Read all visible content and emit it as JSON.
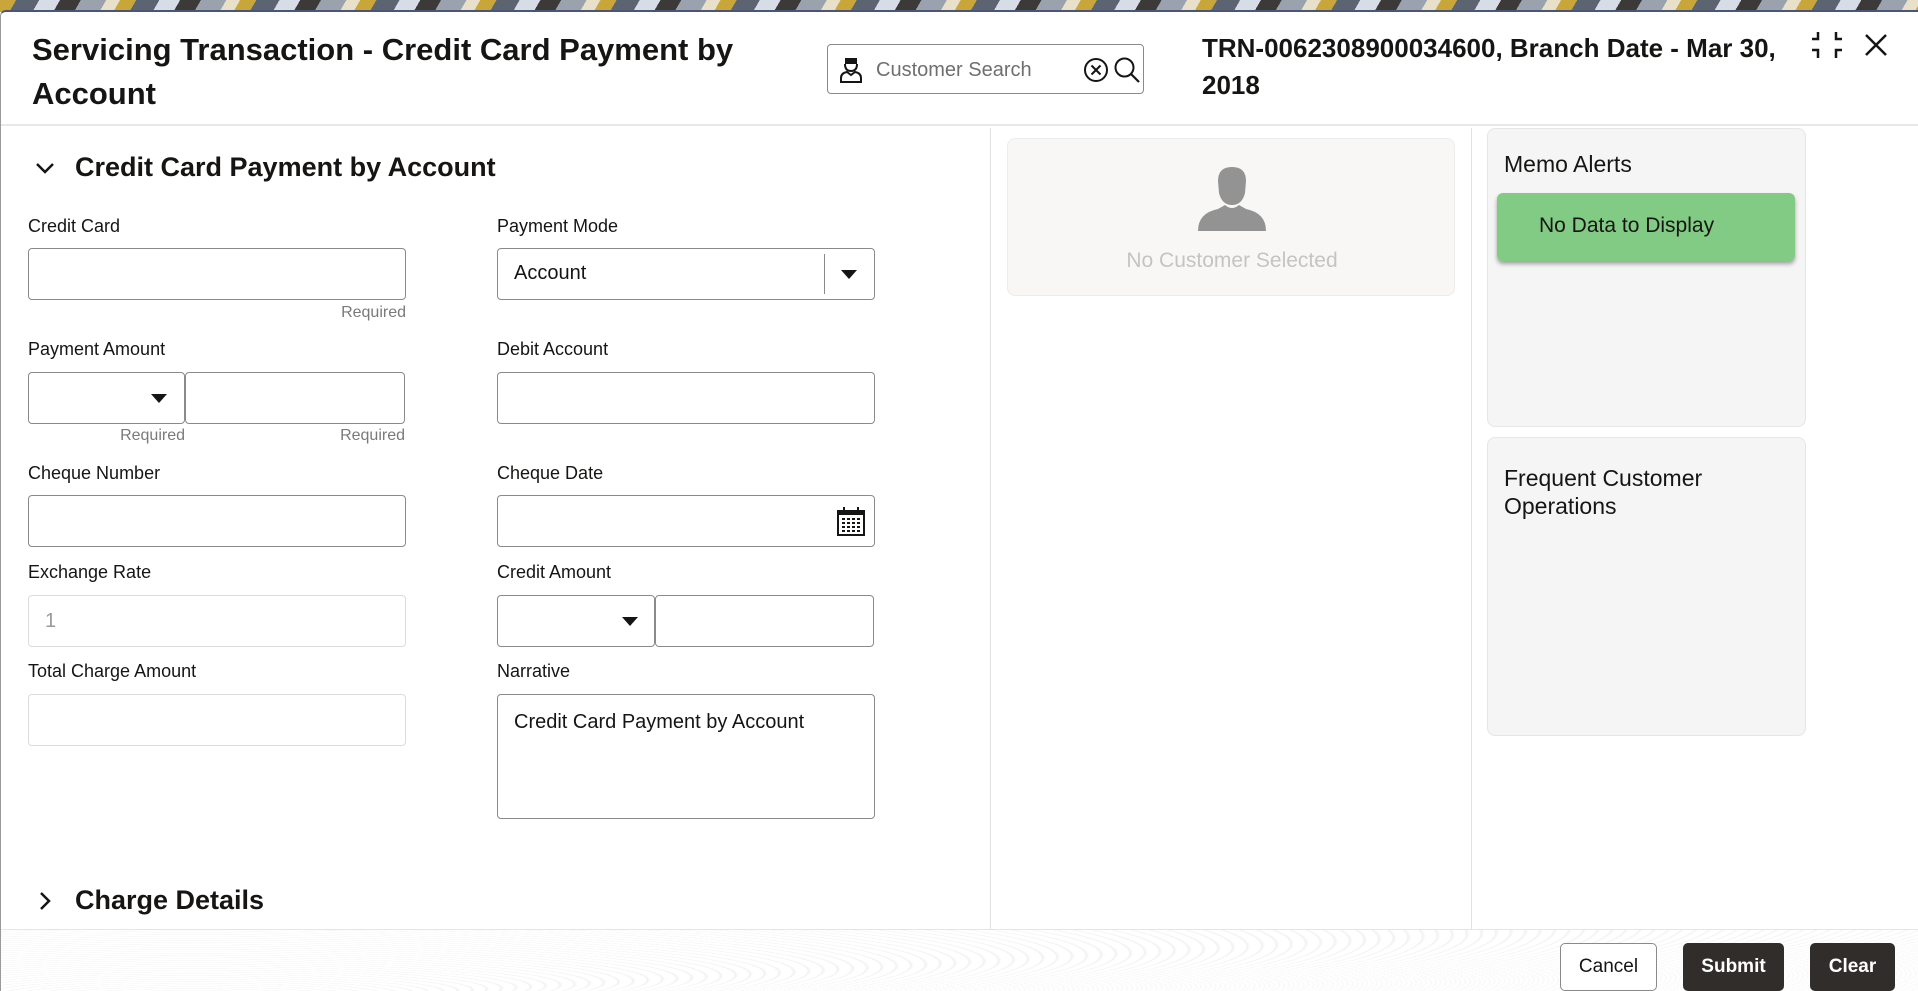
{
  "header": {
    "title": "Servicing Transaction - Credit Card Payment by Account",
    "search": {
      "placeholder": "Customer Search",
      "value": ""
    },
    "transaction_info": "TRN-0062308900034600, Branch Date - Mar 30, 2018",
    "icons": {
      "person": "person-icon",
      "clear": "circle-x-icon",
      "search": "magnifier-icon",
      "minimize": "minimize-icon",
      "close": "close-icon"
    }
  },
  "form": {
    "section_title": "Credit Card Payment by Account",
    "required_text": "Required",
    "fields": {
      "credit_card": {
        "label": "Credit Card",
        "value": ""
      },
      "payment_mode": {
        "label": "Payment Mode",
        "value": "Account"
      },
      "payment_amount": {
        "label": "Payment Amount",
        "currency": "",
        "amount": ""
      },
      "debit_account": {
        "label": "Debit Account",
        "value": ""
      },
      "cheque_number": {
        "label": "Cheque Number",
        "value": ""
      },
      "cheque_date": {
        "label": "Cheque Date",
        "value": ""
      },
      "exchange_rate": {
        "label": "Exchange Rate",
        "value": "1"
      },
      "credit_amount": {
        "label": "Credit Amount",
        "currency": "",
        "amount": ""
      },
      "total_charge_amount": {
        "label": "Total Charge Amount",
        "value": ""
      },
      "narrative": {
        "label": "Narrative",
        "value": "Credit Card Payment by Account"
      }
    },
    "charge_details_title": "Charge Details"
  },
  "customer_panel": {
    "empty_text": "No Customer Selected"
  },
  "memo_alerts": {
    "title": "Memo Alerts",
    "empty_text": "No Data to Display",
    "empty_color": "#82cb84"
  },
  "frequent_operations": {
    "title": "Frequent Customer Operations"
  },
  "footer": {
    "cancel_label": "Cancel",
    "submit_label": "Submit",
    "clear_label": "Clear"
  }
}
